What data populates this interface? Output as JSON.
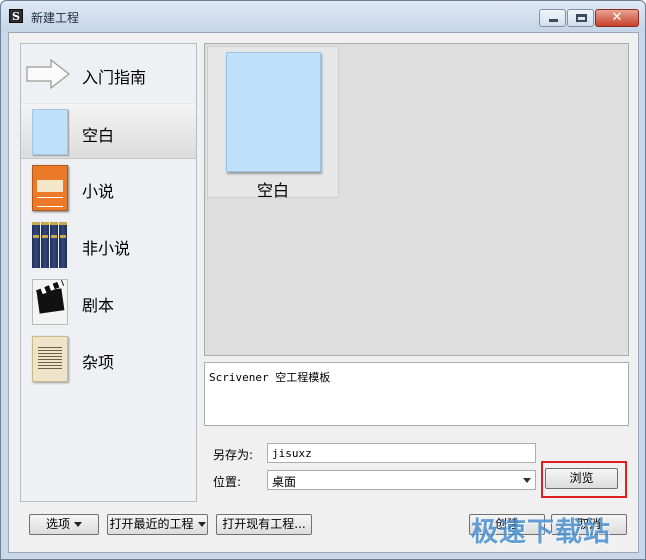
{
  "window": {
    "title": "新建工程",
    "close_glyph": "✕"
  },
  "sidebar": {
    "items": [
      {
        "label": "入门指南",
        "icon": "arrow-icon"
      },
      {
        "label": "空白",
        "icon": "blank-page-icon",
        "selected": true
      },
      {
        "label": "小说",
        "icon": "novel-book-icon"
      },
      {
        "label": "非小说",
        "icon": "books-icon"
      },
      {
        "label": "剧本",
        "icon": "clapperboard-icon"
      },
      {
        "label": "杂项",
        "icon": "document-icon"
      }
    ]
  },
  "templates": [
    {
      "label": "空白",
      "selected": true
    }
  ],
  "description": "Scrivener 空工程模板",
  "form": {
    "save_as_label": "另存为:",
    "save_as_value": "jisuxz",
    "location_label": "位置:",
    "location_value": "桌面",
    "browse_label": "浏览"
  },
  "footer": {
    "options_label": "选项",
    "open_recent_label": "打开最近的工程",
    "open_existing_label": "打开现有工程...",
    "create_label": "创建",
    "cancel_label": "取消"
  },
  "watermark": "极速下载站",
  "colors": {
    "highlight_box": "#e02020",
    "template_blue": "#bfe0fb"
  }
}
